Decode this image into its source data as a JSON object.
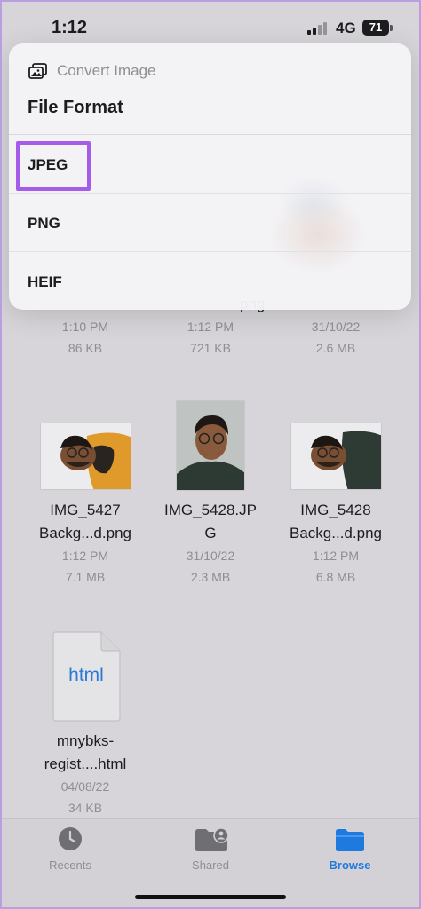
{
  "status_bar": {
    "time": "1:12",
    "network": "4G",
    "battery": "71"
  },
  "menu": {
    "icon": "photo-stack-icon",
    "subtitle": "Convert Image",
    "title": "File Format",
    "options": [
      {
        "label": "JPEG",
        "highlighted": true
      },
      {
        "label": "PNG",
        "highlighted": false
      },
      {
        "label": "HEIF",
        "highlighted": false
      }
    ],
    "highlight_color": "#a55ce8"
  },
  "files_row0": [
    {
      "name_tail": "",
      "date": "1:10 PM",
      "size": "86 KB"
    },
    {
      "name_tail": "png",
      "date": "1:12 PM",
      "size": "721 KB"
    },
    {
      "name_tail": "",
      "date": "31/10/22",
      "size": "2.6 MB"
    }
  ],
  "files_row1": [
    {
      "name_line1": "IMG_5427",
      "name_line2": "Backg...d.png",
      "date": "1:12 PM",
      "size": "7.1 MB"
    },
    {
      "name_line1": "IMG_5428.JP",
      "name_line2": "G",
      "date": "31/10/22",
      "size": "2.3 MB"
    },
    {
      "name_line1": "IMG_5428",
      "name_line2": "Backg...d.png",
      "date": "1:12 PM",
      "size": "6.8 MB"
    }
  ],
  "files_row2": [
    {
      "icon_text": "html",
      "name_line1": "mnybks-",
      "name_line2": "regist....html",
      "date": "04/08/22",
      "size": "34 KB"
    }
  ],
  "tab_bar": {
    "tabs": [
      {
        "label": "Recents",
        "icon": "clock-icon",
        "active": false
      },
      {
        "label": "Shared",
        "icon": "shared-folder-icon",
        "active": false
      },
      {
        "label": "Browse",
        "icon": "folder-icon",
        "active": true
      }
    ],
    "active_color": "#1f7ae0",
    "inactive_color": "#8e8e93"
  }
}
